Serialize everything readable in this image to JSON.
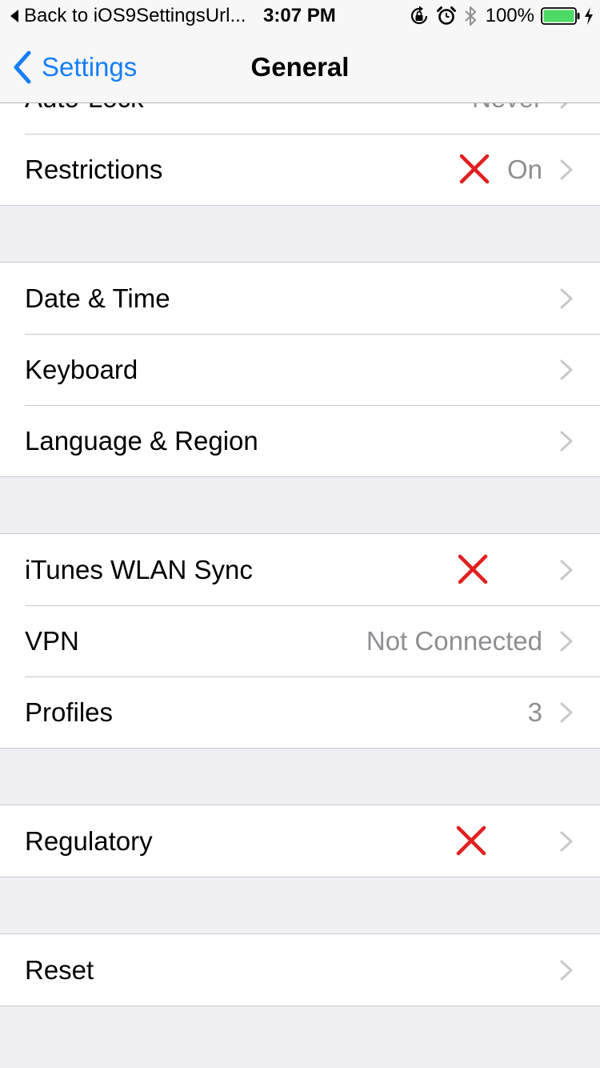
{
  "status_bar": {
    "back_label": "Back to iOS9SettingsUrl...",
    "time": "3:07 PM",
    "battery_percent": "100%",
    "icons": [
      "orientation-lock-icon",
      "alarm-icon",
      "bluetooth-icon",
      "battery-icon",
      "charging-bolt-icon"
    ]
  },
  "nav_bar": {
    "back_label": "Settings",
    "title": "General"
  },
  "colors": {
    "accent": "#157efb",
    "marker_red": "#e02020",
    "battery_green": "#4cd964",
    "secondary_text": "#8e8e93",
    "background": "#efeff4"
  },
  "rows": {
    "auto_lock": {
      "label": "Auto-Lock",
      "value": "Never"
    },
    "restrictions": {
      "label": "Restrictions",
      "value": "On"
    },
    "date_time": {
      "label": "Date & Time",
      "value": ""
    },
    "keyboard": {
      "label": "Keyboard",
      "value": ""
    },
    "language_region": {
      "label": "Language & Region",
      "value": ""
    },
    "itunes_wlan_sync": {
      "label": "iTunes WLAN Sync",
      "value": ""
    },
    "vpn": {
      "label": "VPN",
      "value": "Not Connected"
    },
    "profiles": {
      "label": "Profiles",
      "value": "3"
    },
    "regulatory": {
      "label": "Regulatory",
      "value": ""
    },
    "reset": {
      "label": "Reset",
      "value": ""
    }
  }
}
